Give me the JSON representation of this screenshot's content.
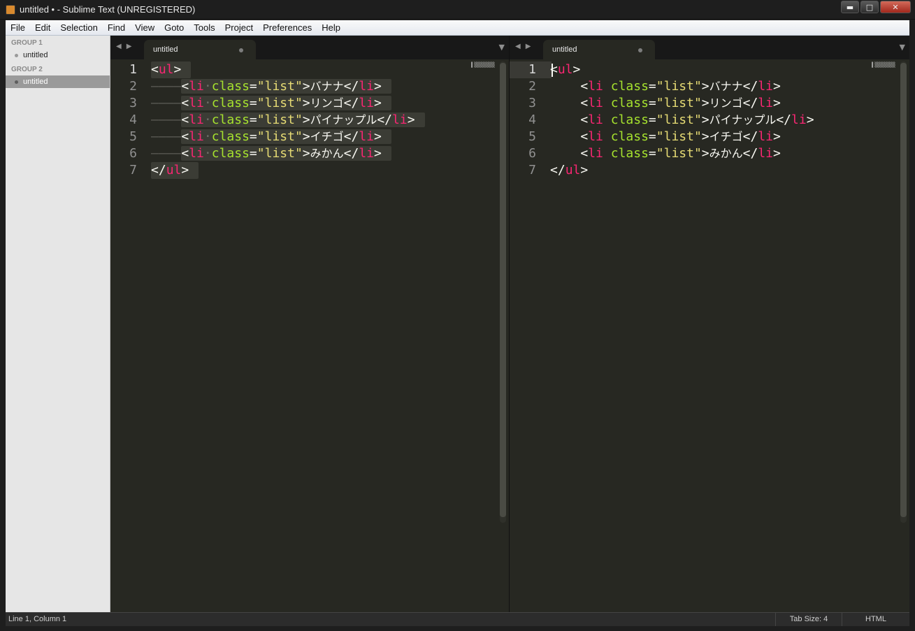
{
  "window": {
    "title": "untitled • - Sublime Text (UNREGISTERED)",
    "buttons": {
      "minimize": "▬",
      "maximize": "□",
      "close": "✕"
    }
  },
  "menu": [
    "File",
    "Edit",
    "Selection",
    "Find",
    "View",
    "Goto",
    "Tools",
    "Project",
    "Preferences",
    "Help"
  ],
  "sidebar": {
    "groups": [
      {
        "label": "GROUP 1",
        "files": [
          "untitled"
        ]
      },
      {
        "label": "GROUP 2",
        "files": [
          "untitled"
        ]
      }
    ]
  },
  "editors": {
    "left": {
      "tab": {
        "label": "untitled",
        "modified": true
      },
      "line_numbers": [
        "1",
        "2",
        "3",
        "4",
        "5",
        "6",
        "7"
      ],
      "lines": [
        {
          "indent": "",
          "open": "<",
          "tag": "ul",
          "close": ">"
        },
        {
          "indent": "――――",
          "open": "<",
          "tag": "li",
          "ws": "·",
          "attr": "class",
          "eq": "=",
          "value": "\"list\"",
          "gt": ">",
          "text": "バナナ",
          "endopen": "</",
          "endtag": "li",
          "endclose": ">"
        },
        {
          "indent": "――――",
          "open": "<",
          "tag": "li",
          "ws": "·",
          "attr": "class",
          "eq": "=",
          "value": "\"list\"",
          "gt": ">",
          "text": "リンゴ",
          "endopen": "</",
          "endtag": "li",
          "endclose": ">"
        },
        {
          "indent": "――――",
          "open": "<",
          "tag": "li",
          "ws": "·",
          "attr": "class",
          "eq": "=",
          "value": "\"list\"",
          "gt": ">",
          "text": "パイナップル",
          "endopen": "</",
          "endtag": "li",
          "endclose": ">"
        },
        {
          "indent": "――――",
          "open": "<",
          "tag": "li",
          "ws": "·",
          "attr": "class",
          "eq": "=",
          "value": "\"list\"",
          "gt": ">",
          "text": "イチゴ",
          "endopen": "</",
          "endtag": "li",
          "endclose": ">"
        },
        {
          "indent": "――――",
          "open": "<",
          "tag": "li",
          "ws": "·",
          "attr": "class",
          "eq": "=",
          "value": "\"list\"",
          "gt": ">",
          "text": "みかん",
          "endopen": "</",
          "endtag": "li",
          "endclose": ">"
        },
        {
          "indent": "",
          "open": "</",
          "tag": "ul",
          "close": ">"
        }
      ]
    },
    "right": {
      "tab": {
        "label": "untitled",
        "modified": true
      },
      "line_numbers": [
        "1",
        "2",
        "3",
        "4",
        "5",
        "6",
        "7"
      ],
      "lines": [
        {
          "indent": "",
          "open": "<",
          "tag": "ul",
          "close": ">"
        },
        {
          "indent": "    ",
          "open": "<",
          "tag": "li",
          "ws": " ",
          "attr": "class",
          "eq": "=",
          "value": "\"list\"",
          "gt": ">",
          "text": "バナナ",
          "endopen": "</",
          "endtag": "li",
          "endclose": ">"
        },
        {
          "indent": "    ",
          "open": "<",
          "tag": "li",
          "ws": " ",
          "attr": "class",
          "eq": "=",
          "value": "\"list\"",
          "gt": ">",
          "text": "リンゴ",
          "endopen": "</",
          "endtag": "li",
          "endclose": ">"
        },
        {
          "indent": "    ",
          "open": "<",
          "tag": "li",
          "ws": " ",
          "attr": "class",
          "eq": "=",
          "value": "\"list\"",
          "gt": ">",
          "text": "パイナップル",
          "endopen": "</",
          "endtag": "li",
          "endclose": ">"
        },
        {
          "indent": "    ",
          "open": "<",
          "tag": "li",
          "ws": " ",
          "attr": "class",
          "eq": "=",
          "value": "\"list\"",
          "gt": ">",
          "text": "イチゴ",
          "endopen": "</",
          "endtag": "li",
          "endclose": ">"
        },
        {
          "indent": "    ",
          "open": "<",
          "tag": "li",
          "ws": " ",
          "attr": "class",
          "eq": "=",
          "value": "\"list\"",
          "gt": ">",
          "text": "みかん",
          "endopen": "</",
          "endtag": "li",
          "endclose": ">"
        },
        {
          "indent": "",
          "open": "</",
          "tag": "ul",
          "close": ">"
        }
      ]
    }
  },
  "status": {
    "position": "Line 1, Column 1",
    "tab_size": "Tab Size: 4",
    "syntax": "HTML"
  },
  "colors": {
    "background": "#272822",
    "tag": "#f92672",
    "attribute": "#a6e22e",
    "string": "#e6db74",
    "text": "#f8f8f2"
  }
}
